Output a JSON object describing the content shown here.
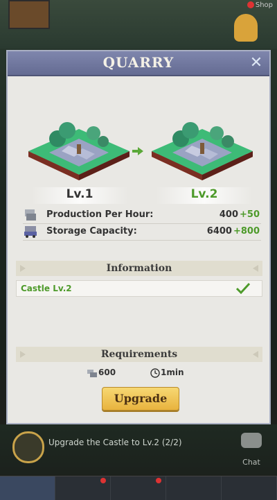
{
  "background": {
    "shop_label": "Shop",
    "quest_text": "Upgrade the Castle to Lv.2 (2/2)",
    "chat_label": "Chat"
  },
  "dialog": {
    "title": "QUARRY",
    "current_level": "Lv.1",
    "next_level": "Lv.2",
    "stats": [
      {
        "label": "Production Per Hour:",
        "value": "400",
        "bonus": "+50",
        "icon": "stone-production-icon"
      },
      {
        "label": "Storage Capacity:",
        "value": "6400",
        "bonus": "+800",
        "icon": "storage-cart-icon"
      }
    ],
    "information": {
      "heading": "Information",
      "condition": "Castle Lv.2",
      "condition_met": true
    },
    "requirements": {
      "heading": "Requirements",
      "stone": "600",
      "time": "1min"
    },
    "upgrade_label": "Upgrade"
  },
  "colors": {
    "header": "#727aa0",
    "accent_green": "#4d9a2a",
    "button_gold": "#f0c455"
  }
}
